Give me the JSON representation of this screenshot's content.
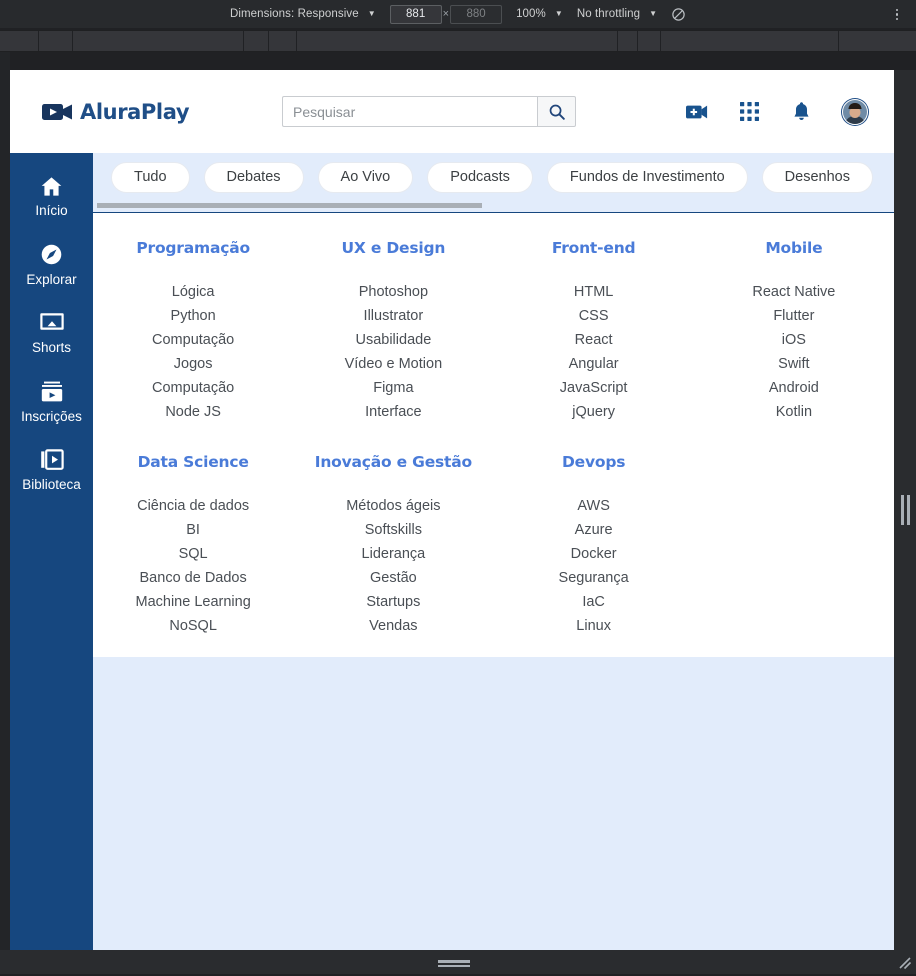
{
  "devtools": {
    "dimensions_label": "Dimensions: Responsive",
    "width_value": "881",
    "height_value": "880",
    "zoom_value": "100%",
    "throttling_value": "No throttling",
    "multiply_symbol": "×",
    "caret": "▼",
    "throttle_icon": "no-throttling-icon",
    "kebab_icon": "more-options-icon"
  },
  "header": {
    "logo_text": "AluraPlay",
    "logo_icon": "video-camera-icon",
    "search": {
      "placeholder": "Pesquisar",
      "value": "",
      "button_icon": "search-icon"
    },
    "actions": [
      {
        "name": "create-video-icon",
        "label": ""
      },
      {
        "name": "apps-grid-icon",
        "label": ""
      },
      {
        "name": "notifications-bell-icon",
        "label": ""
      },
      {
        "name": "avatar",
        "label": ""
      }
    ]
  },
  "sidebar": {
    "items": [
      {
        "label": "Início",
        "icon": "home-icon"
      },
      {
        "label": "Explorar",
        "icon": "compass-icon"
      },
      {
        "label": "Shorts",
        "icon": "cast-screen-icon"
      },
      {
        "label": "Inscrições",
        "icon": "subscriptions-icon"
      },
      {
        "label": "Biblioteca",
        "icon": "library-icon"
      }
    ]
  },
  "chips": [
    {
      "label": "Tudo"
    },
    {
      "label": "Debates"
    },
    {
      "label": "Ao Vivo"
    },
    {
      "label": "Podcasts"
    },
    {
      "label": "Fundos de Investimento"
    },
    {
      "label": "Desenhos"
    }
  ],
  "categories_row_1": [
    {
      "title": "Programação",
      "items": [
        "Lógica",
        "Python",
        "Computação",
        "Jogos",
        "Computação",
        "Node JS"
      ]
    },
    {
      "title": "UX e Design",
      "items": [
        "Photoshop",
        "Illustrator",
        "Usabilidade",
        "Vídeo e Motion",
        "Figma",
        "Interface"
      ]
    },
    {
      "title": "Front-end",
      "items": [
        "HTML",
        "CSS",
        "React",
        "Angular",
        "JavaScript",
        "jQuery"
      ]
    },
    {
      "title": "Mobile",
      "items": [
        "React Native",
        "Flutter",
        "iOS",
        "Swift",
        "Android",
        "Kotlin"
      ]
    }
  ],
  "categories_row_2": [
    {
      "title": "Data Science",
      "items": [
        "Ciência de dados",
        "BI",
        "SQL",
        "Banco de Dados",
        "Machine Learning",
        "NoSQL"
      ]
    },
    {
      "title": "Inovação e Gestão",
      "items": [
        "Métodos ágeis",
        "Softskills",
        "Liderança",
        "Gestão",
        "Startups",
        "Vendas"
      ]
    },
    {
      "title": "Devops",
      "items": [
        "AWS",
        "Azure",
        "Docker",
        "Segurança",
        "IaC",
        "Linux"
      ]
    },
    {
      "title": "",
      "items": []
    }
  ],
  "colors": {
    "sidebar_blue": "#16477f",
    "content_blue": "#e2ecfb",
    "heading_blue": "#4a7bd8",
    "logo_blue": "#1f4e87",
    "devtools_bg": "#282a2d"
  }
}
